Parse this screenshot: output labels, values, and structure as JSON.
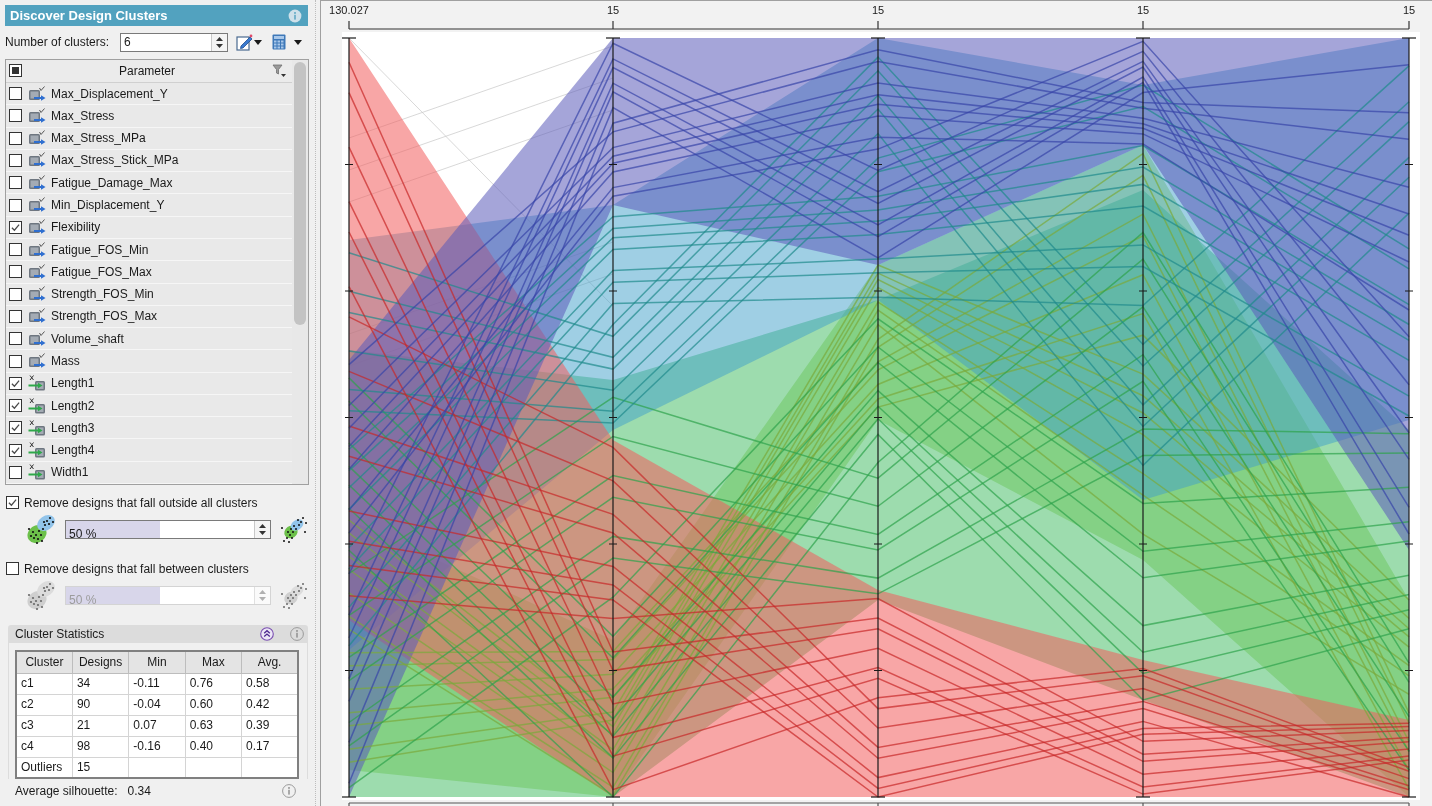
{
  "panel": {
    "title": "Discover Design Clusters"
  },
  "cluster_count": {
    "label": "Number of clusters:",
    "value": "6"
  },
  "parameters": {
    "header": "Parameter",
    "header_indeterminate": true,
    "items": [
      {
        "label": "Max_Displacement_Y",
        "kind": "output",
        "checked": false
      },
      {
        "label": "Max_Stress",
        "kind": "output",
        "checked": false
      },
      {
        "label": "Max_Stress_MPa",
        "kind": "output",
        "checked": false
      },
      {
        "label": "Max_Stress_Stick_MPa",
        "kind": "output",
        "checked": false
      },
      {
        "label": "Fatigue_Damage_Max",
        "kind": "output",
        "checked": false
      },
      {
        "label": "Min_Displacement_Y",
        "kind": "output",
        "checked": false
      },
      {
        "label": "Flexibility",
        "kind": "output",
        "checked": true
      },
      {
        "label": "Fatigue_FOS_Min",
        "kind": "output",
        "checked": false
      },
      {
        "label": "Fatigue_FOS_Max",
        "kind": "output",
        "checked": false
      },
      {
        "label": "Strength_FOS_Min",
        "kind": "output",
        "checked": false
      },
      {
        "label": "Strength_FOS_Max",
        "kind": "output",
        "checked": false
      },
      {
        "label": "Volume_shaft",
        "kind": "output",
        "checked": false
      },
      {
        "label": "Mass",
        "kind": "output",
        "checked": false
      },
      {
        "label": "Length1",
        "kind": "input",
        "checked": true
      },
      {
        "label": "Length2",
        "kind": "input",
        "checked": true
      },
      {
        "label": "Length3",
        "kind": "input",
        "checked": true
      },
      {
        "label": "Length4",
        "kind": "input",
        "checked": true
      },
      {
        "label": "Width1",
        "kind": "input",
        "checked": false
      }
    ]
  },
  "outside_filter": {
    "label": "Remove designs that fall outside all clusters",
    "checked": true,
    "value": "50 %",
    "level": 0.5,
    "disabled": false
  },
  "between_filter": {
    "label": "Remove designs that fall between clusters",
    "checked": false,
    "value": "50 %",
    "level": 0.5,
    "disabled": true
  },
  "cluster_statistics": {
    "title": "Cluster Statistics",
    "expanded": true,
    "columns": [
      "Cluster",
      "Designs",
      "Min",
      "Max",
      "Avg."
    ],
    "rows": [
      [
        "c1",
        "34",
        "-0.11",
        "0.76",
        "0.58"
      ],
      [
        "c2",
        "90",
        "-0.04",
        "0.60",
        "0.42"
      ],
      [
        "c3",
        "21",
        "0.07",
        "0.63",
        "0.39"
      ],
      [
        "c4",
        "98",
        "-0.16",
        "0.40",
        "0.17"
      ],
      [
        "Outliers",
        "15"
      ]
    ]
  },
  "silhouette": {
    "label": "Average silhouette:",
    "value": "0.34"
  },
  "plot": {
    "axis_labels": [
      "130.027",
      "15",
      "15",
      "15",
      "15"
    ]
  }
}
